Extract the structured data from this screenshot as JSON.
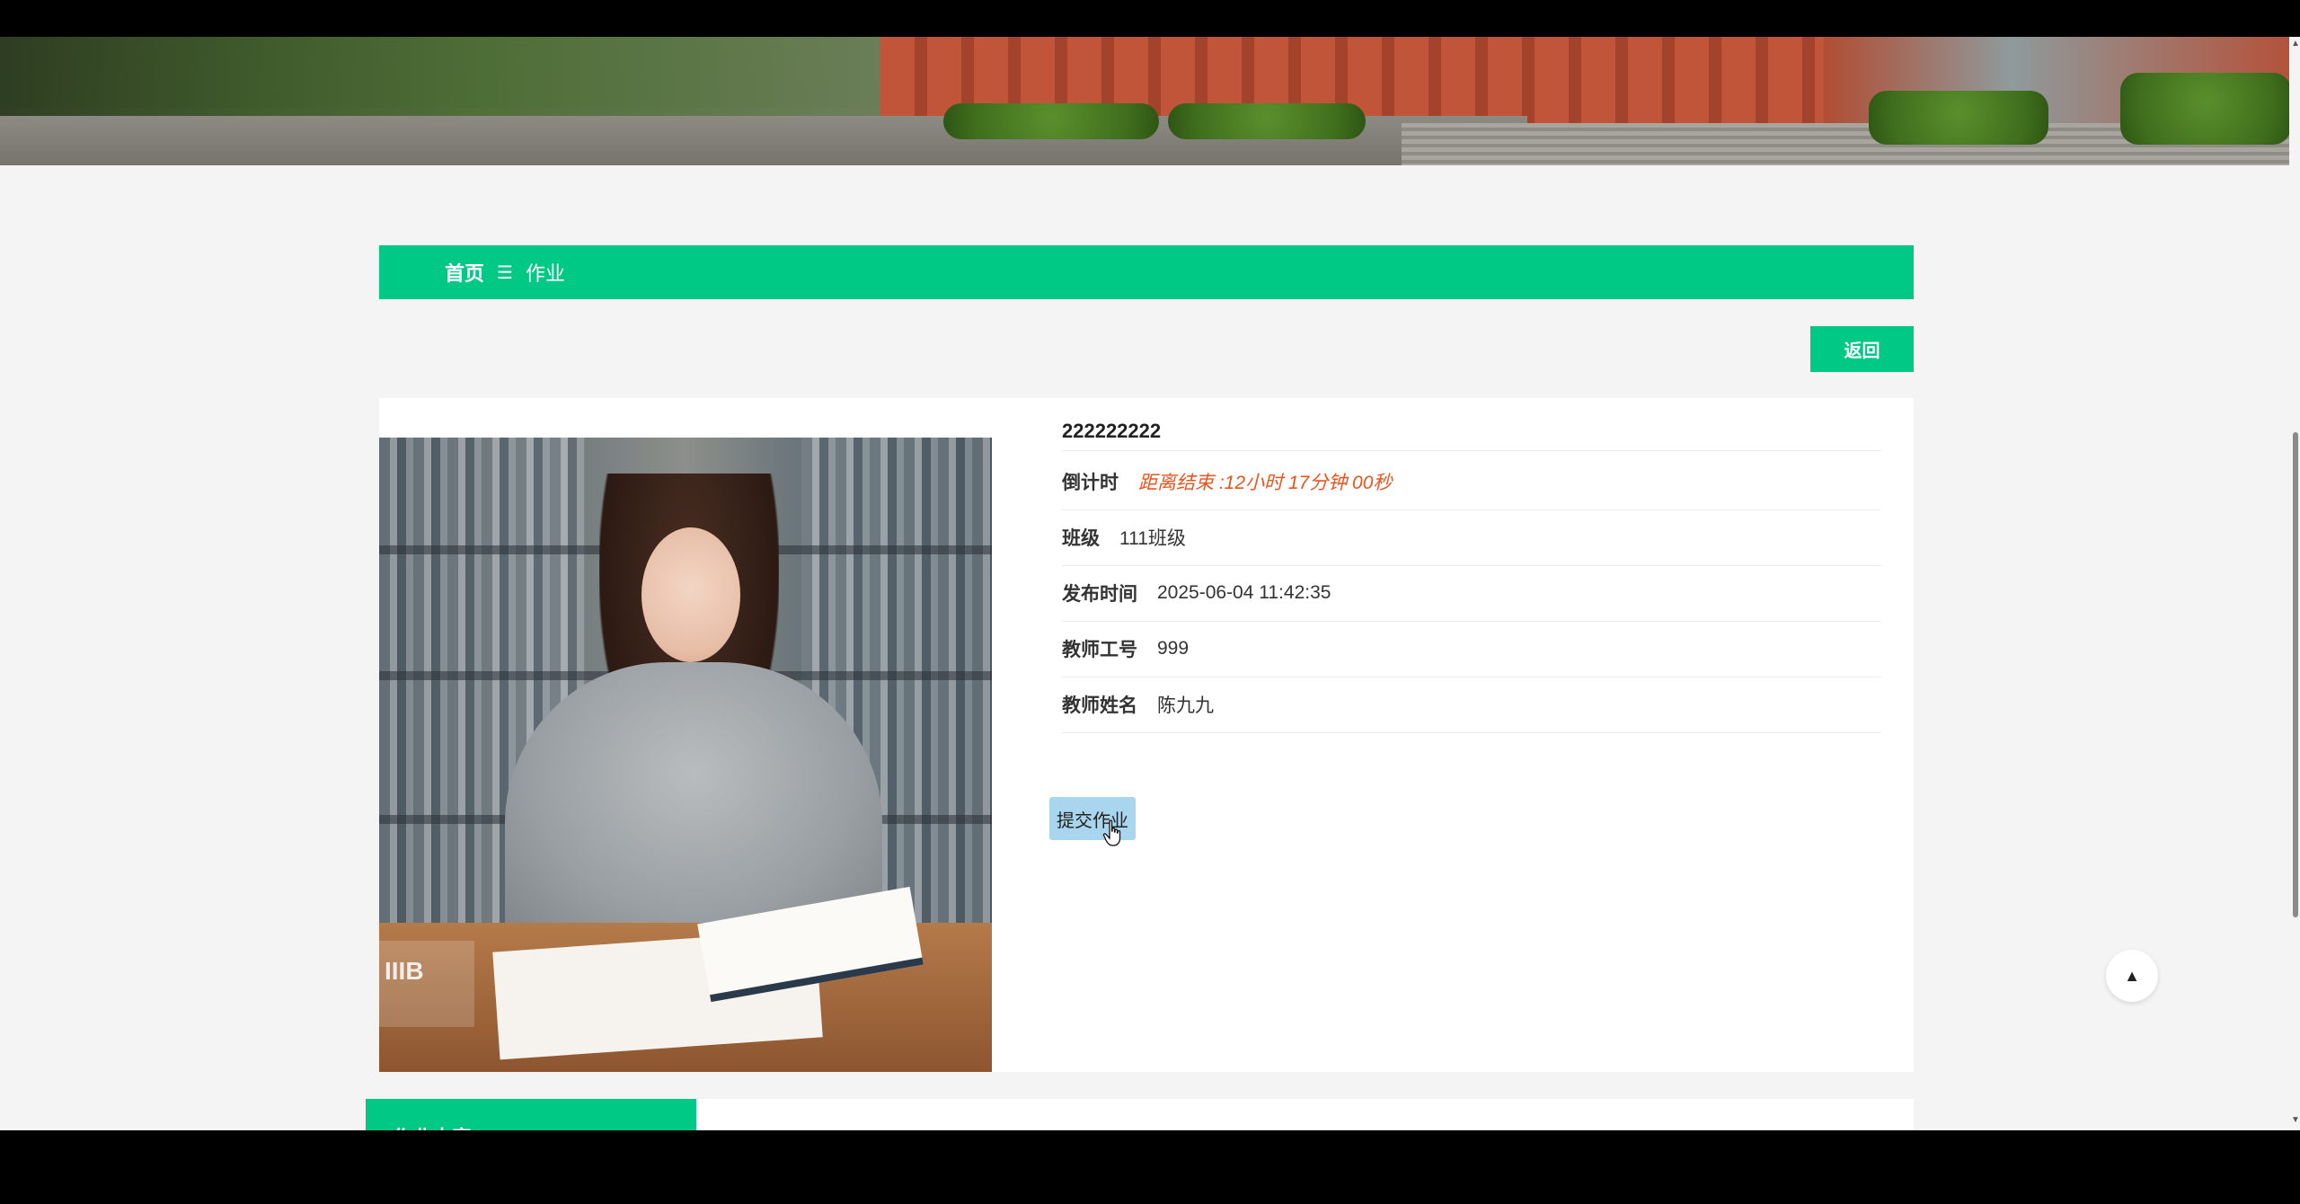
{
  "breadcrumb": {
    "home": "首页",
    "separator": "☰",
    "current": "作业"
  },
  "back_label": "返回",
  "homework": {
    "title": "222222222",
    "countdown_label": "倒计时",
    "countdown_value": "距离结束 :12小时 17分钟 00秒",
    "class_label": "班级",
    "class_value": "111班级",
    "publish_label": "发布时间",
    "publish_value": "2025-06-04 11:42:35",
    "teacher_id_label": "教师工号",
    "teacher_id_value": "999",
    "teacher_name_label": "教师姓名",
    "teacher_name_value": "陈九九"
  },
  "submit_label": "提交作业",
  "section_tab_label": "作业内容",
  "watermark_text": "IIIB",
  "icons": {
    "back_to_top": "arrow-up-icon",
    "cursor": "pointer-hand-icon"
  },
  "colors": {
    "accent": "#00c985",
    "countdown": "#e8541e",
    "submit_button": "#a9d6ee"
  }
}
